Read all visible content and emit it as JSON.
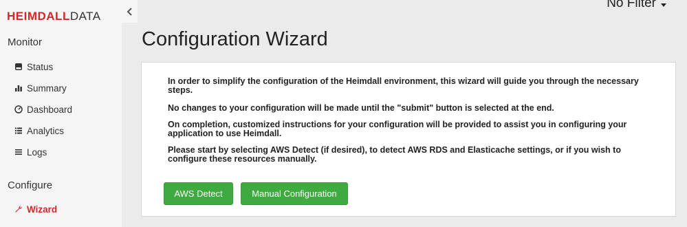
{
  "brand": {
    "part1": "HEIMDALL",
    "part2": "DATA"
  },
  "header": {
    "filter_label": "No Filter"
  },
  "sidebar": {
    "monitor_title": "Monitor",
    "monitor_items": [
      {
        "label": "Status",
        "icon": "hdd-icon"
      },
      {
        "label": "Summary",
        "icon": "bar-chart-icon"
      },
      {
        "label": "Dashboard",
        "icon": "dashboard-icon"
      },
      {
        "label": "Analytics",
        "icon": "list-icon"
      },
      {
        "label": "Logs",
        "icon": "lines-icon"
      }
    ],
    "configure_title": "Configure",
    "configure_items": [
      {
        "label": "Wizard",
        "icon": "wrench-icon",
        "active": true
      }
    ]
  },
  "main": {
    "title": "Configuration Wizard",
    "paragraphs": [
      "In order to simplify the configuration of the Heimdall environment, this wizard will guide you through the necessary steps.",
      "No changes to your configuration will be made until the \"submit\" button is selected at the end.",
      "On completion, customized instructions for your configuration will be provided to assist you in configuring your application to use Heimdall.",
      "Please start by selecting AWS Detect (if desired), to detect AWS RDS and Elasticache settings, or if you wish to configure these resources manually."
    ],
    "aws_detect_label": "AWS Detect",
    "manual_config_label": "Manual Configuration"
  },
  "colors": {
    "accent": "#d7262b",
    "button": "#3faa3f"
  }
}
